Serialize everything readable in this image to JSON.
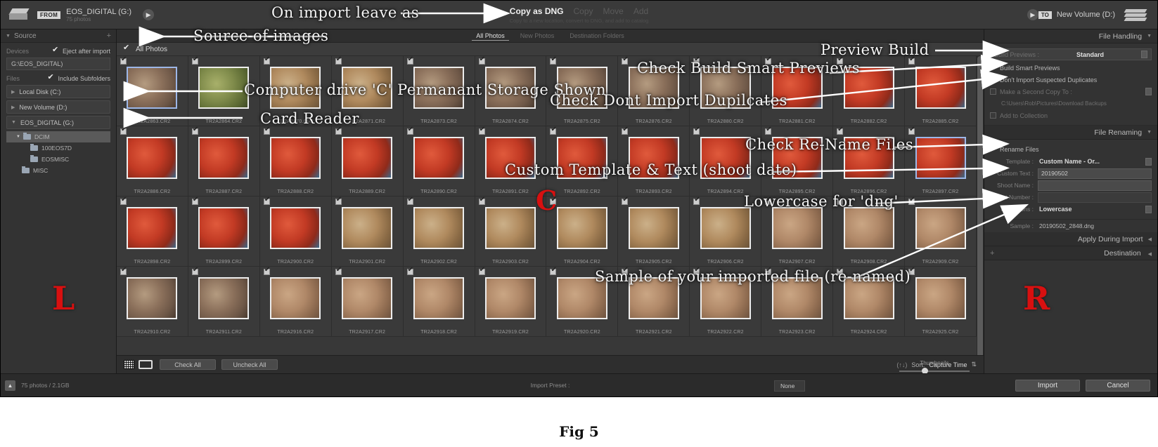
{
  "window": {
    "topbar": {
      "from_chip": "FROM",
      "source_name": "EOS_DIGITAL (G:)",
      "source_sub": "75 photos",
      "modes": [
        {
          "label": "Copy as DNG",
          "active": true
        },
        {
          "label": "Copy",
          "active": false
        },
        {
          "label": "Move",
          "active": false
        },
        {
          "label": "Add",
          "active": false
        }
      ],
      "mode_sub": "Copy to a new location, convert to DNG, and add to catalog",
      "to_chip": "TO",
      "dest_name": "New Volume (D:)"
    }
  },
  "left_panel": {
    "title": "Source",
    "plus": "+",
    "devices_label": "Devices",
    "eject_label": "Eject after import",
    "device_value": "G:\\EOS_DIGITAL)",
    "files_label": "Files",
    "include_subfolders": "Include Subfolders",
    "drives": [
      {
        "label": "Local Disk (C:)",
        "expanded": false
      },
      {
        "label": "New Volume (D:)",
        "expanded": false
      },
      {
        "label": "EOS_DIGITAL (G:)",
        "expanded": true
      }
    ],
    "folders": [
      {
        "label": "DCIM",
        "indent": 1,
        "selected": true
      },
      {
        "label": "100EOS7D",
        "indent": 2,
        "selected": false
      },
      {
        "label": "EOSMISC",
        "indent": 2,
        "selected": false
      },
      {
        "label": "MISC",
        "indent": 1,
        "selected": false
      }
    ]
  },
  "center": {
    "tabs": [
      {
        "label": "All Photos",
        "active": true
      },
      {
        "label": "New Photos",
        "active": false
      },
      {
        "label": "Destination Folders",
        "active": false
      }
    ],
    "all_photos_label": "All Photos",
    "toolbar": {
      "grid_view_icon": "grid-view-icon",
      "loupe_view_icon": "loupe-view-icon",
      "check_all": "Check All",
      "uncheck_all": "Uncheck All",
      "sort_label": "Sort:",
      "sort_value": "Capture Time",
      "thumbnails_label": "Thumbnails"
    },
    "cells": [
      {
        "file": "TR2A2863.CR2",
        "kind": "rock",
        "selected": true
      },
      {
        "file": "TR2A2864.CR2",
        "kind": "leaf",
        "selected": false
      },
      {
        "file": "TR2A2870.CR2",
        "kind": "bird",
        "selected": false
      },
      {
        "file": "TR2A2871.CR2",
        "kind": "bird",
        "selected": false
      },
      {
        "file": "TR2A2873.CR2",
        "kind": "rock",
        "selected": false
      },
      {
        "file": "TR2A2874.CR2",
        "kind": "rock",
        "selected": false
      },
      {
        "file": "TR2A2875.CR2",
        "kind": "rock",
        "selected": false
      },
      {
        "file": "TR2A2876.CR2",
        "kind": "rock",
        "selected": false
      },
      {
        "file": "TR2A2880.CR2",
        "kind": "rock",
        "selected": false
      },
      {
        "file": "TR2A2881.CR2",
        "kind": "flower",
        "selected": false
      },
      {
        "file": "TR2A2882.CR2",
        "kind": "flower",
        "selected": false
      },
      {
        "file": "TR2A2885.CR2",
        "kind": "flower",
        "selected": false
      },
      {
        "file": "TR2A2886.CR2",
        "kind": "flower",
        "selected": false
      },
      {
        "file": "TR2A2887.CR2",
        "kind": "flower",
        "selected": false
      },
      {
        "file": "TR2A2888.CR2",
        "kind": "flower",
        "selected": false
      },
      {
        "file": "TR2A2889.CR2",
        "kind": "flower",
        "selected": false
      },
      {
        "file": "TR2A2890.CR2",
        "kind": "flower",
        "selected": false
      },
      {
        "file": "TR2A2891.CR2",
        "kind": "flower",
        "selected": false
      },
      {
        "file": "TR2A2892.CR2",
        "kind": "flower",
        "selected": false
      },
      {
        "file": "TR2A2893.CR2",
        "kind": "flower",
        "selected": false
      },
      {
        "file": "TR2A2894.CR2",
        "kind": "flower",
        "selected": false
      },
      {
        "file": "TR2A2895.CR2",
        "kind": "flower",
        "selected": false
      },
      {
        "file": "TR2A2896.CR2",
        "kind": "flower",
        "selected": false
      },
      {
        "file": "TR2A2897.CR2",
        "kind": "flower",
        "selected": true
      },
      {
        "file": "TR2A2898.CR2",
        "kind": "flower",
        "selected": false
      },
      {
        "file": "TR2A2899.CR2",
        "kind": "flower",
        "selected": false
      },
      {
        "file": "TR2A2900.CR2",
        "kind": "flower",
        "selected": false
      },
      {
        "file": "TR2A2901.CR2",
        "kind": "bird",
        "selected": false
      },
      {
        "file": "TR2A2902.CR2",
        "kind": "bird",
        "selected": false
      },
      {
        "file": "TR2A2903.CR2",
        "kind": "bird",
        "selected": false
      },
      {
        "file": "TR2A2904.CR2",
        "kind": "bird",
        "selected": false
      },
      {
        "file": "TR2A2905.CR2",
        "kind": "bird",
        "selected": false
      },
      {
        "file": "TR2A2906.CR2",
        "kind": "bird",
        "selected": false
      },
      {
        "file": "TR2A2907.CR2",
        "kind": "sand",
        "selected": false
      },
      {
        "file": "TR2A2908.CR2",
        "kind": "sand",
        "selected": false
      },
      {
        "file": "TR2A2909.CR2",
        "kind": "sand",
        "selected": false
      },
      {
        "file": "TR2A2910.CR2",
        "kind": "rock",
        "selected": false
      },
      {
        "file": "TR2A2911.CR2",
        "kind": "rock",
        "selected": false
      },
      {
        "file": "TR2A2916.CR2",
        "kind": "sand",
        "selected": false
      },
      {
        "file": "TR2A2917.CR2",
        "kind": "sand",
        "selected": false
      },
      {
        "file": "TR2A2918.CR2",
        "kind": "sand",
        "selected": false
      },
      {
        "file": "TR2A2919.CR2",
        "kind": "sand",
        "selected": false
      },
      {
        "file": "TR2A2920.CR2",
        "kind": "sand",
        "selected": false
      },
      {
        "file": "TR2A2921.CR2",
        "kind": "sand",
        "selected": false
      },
      {
        "file": "TR2A2922.CR2",
        "kind": "sand",
        "selected": false
      },
      {
        "file": "TR2A2923.CR2",
        "kind": "sand",
        "selected": false
      },
      {
        "file": "TR2A2924.CR2",
        "kind": "sand",
        "selected": false
      },
      {
        "file": "TR2A2925.CR2",
        "kind": "sand",
        "selected": false
      }
    ]
  },
  "right_panel": {
    "file_handling": {
      "title": "File Handling",
      "build_previews_label": "Build Previews :",
      "build_previews_value": "Standard",
      "build_smart_previews": "Build Smart Previews",
      "dont_import_duplicates": "Don't Import Suspected Duplicates",
      "make_second_copy": "Make a Second Copy To :",
      "second_copy_path": "C:\\Users\\Rob\\Pictures\\Download Backups",
      "add_to_collection": "Add to Collection"
    },
    "file_renaming": {
      "title": "File Renaming",
      "rename_files": "Rename Files",
      "template_label": "Template :",
      "template_value": "Custom Name - Or...",
      "custom_text_label": "Custom Text :",
      "custom_text_value": "20190502",
      "shoot_name_label": "Shoot Name :",
      "shoot_name_value": "",
      "start_number_label": "Start Number :",
      "start_number_value": "",
      "extensions_label": "Extensions :",
      "extensions_value": "Lowercase",
      "sample_label": "Sample :",
      "sample_value": "20190502_2848.dng"
    },
    "apply_during_import": {
      "title": "Apply During Import"
    },
    "destination": {
      "title": "Destination",
      "plus": "+"
    }
  },
  "footer": {
    "photo_count": "75 photos / 2.1GB",
    "import_preset_label": "Import Preset :",
    "import_preset_value": "None",
    "import_button": "Import",
    "cancel_button": "Cancel"
  },
  "annotations": {
    "on_import_leave_as": "On import leave as",
    "source_of_images": "Source of images",
    "preview_build": "Preview Build",
    "computer_drive": "Computer drive 'C' Permanant Storage Shown",
    "card_reader": "Card Reader",
    "check_build_smart": "Check Build Smart Previews",
    "check_dont_import": "Check Dont Import Dupilcates",
    "check_rename": "Check Re-Name Files",
    "custom_template": "Custom Template & Text (shoot date)",
    "lowercase": "Lowercase for 'dng'",
    "sample_of_file": "Sample  of your imported file (re-named)",
    "letter_left": "L",
    "letter_center": "C",
    "letter_right": "R",
    "figure_caption": "Fig 5"
  }
}
